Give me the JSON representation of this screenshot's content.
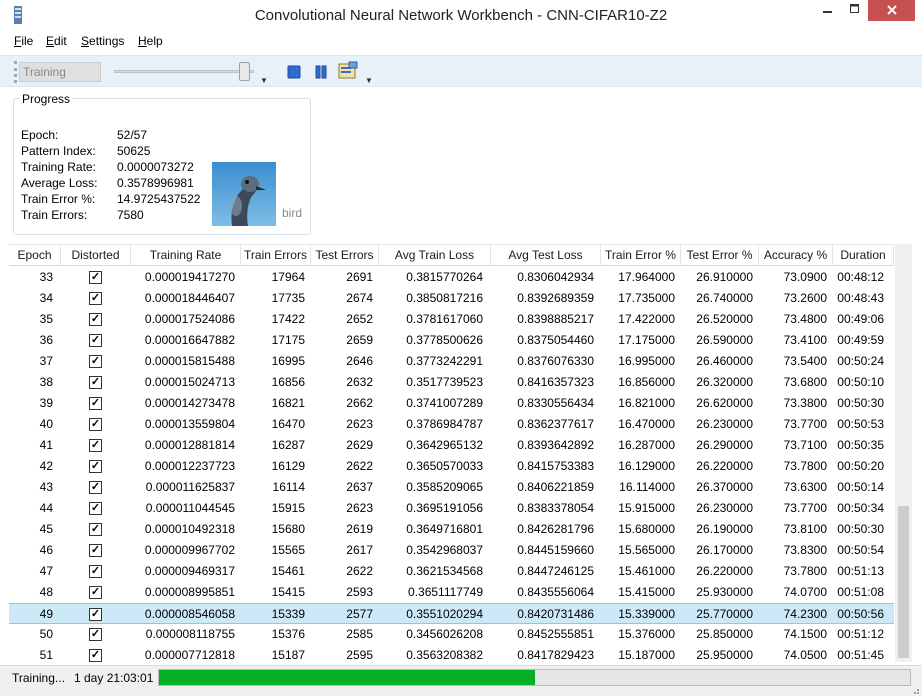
{
  "window": {
    "title": "Convolutional Neural Network Workbench - CNN-CIFAR10-Z2"
  },
  "menu": [
    {
      "label": "File",
      "mnemonic": "F",
      "rest": "ile"
    },
    {
      "label": "Edit",
      "mnemonic": "E",
      "rest": "dit"
    },
    {
      "label": "Settings",
      "mnemonic": "S",
      "rest": "ettings"
    },
    {
      "label": "Help",
      "mnemonic": "H",
      "rest": "elp"
    }
  ],
  "toolbar": {
    "training_field": "Training",
    "slider_level": 1.0,
    "stop_icon": "stop-icon",
    "pause_icon": "pause-icon",
    "settings_icon": "settings-icon"
  },
  "progress": {
    "legend": "Progress",
    "labels": [
      "Epoch:",
      "Pattern Index:",
      "Training Rate:",
      "Average Loss:",
      "Train Error %:",
      "Train Errors:"
    ],
    "values": [
      "52/57",
      "50625",
      "0.0000073272",
      "0.3578996981",
      "14.9725437522",
      "7580"
    ],
    "sample_label": "bird"
  },
  "grid": {
    "columns": [
      "Epoch",
      "Distorted",
      "Training Rate",
      "Train Errors",
      "Test Errors",
      "Avg Train Loss",
      "Avg Test Loss",
      "Train Error %",
      "Test Error %",
      "Accuracy %",
      "Duration"
    ],
    "selected_epoch": "49",
    "rows": [
      [
        "33",
        true,
        "0.000019417270",
        "17964",
        "2691",
        "0.3815770264",
        "0.8306042934",
        "17.964000",
        "26.910000",
        "73.0900",
        "00:48:12"
      ],
      [
        "34",
        true,
        "0.000018446407",
        "17735",
        "2674",
        "0.3850817216",
        "0.8392689359",
        "17.735000",
        "26.740000",
        "73.2600",
        "00:48:43"
      ],
      [
        "35",
        true,
        "0.000017524086",
        "17422",
        "2652",
        "0.3781617060",
        "0.8398885217",
        "17.422000",
        "26.520000",
        "73.4800",
        "00:49:06"
      ],
      [
        "36",
        true,
        "0.000016647882",
        "17175",
        "2659",
        "0.3778500626",
        "0.8375054460",
        "17.175000",
        "26.590000",
        "73.4100",
        "00:49:59"
      ],
      [
        "37",
        true,
        "0.000015815488",
        "16995",
        "2646",
        "0.3773242291",
        "0.8376076330",
        "16.995000",
        "26.460000",
        "73.5400",
        "00:50:24"
      ],
      [
        "38",
        true,
        "0.000015024713",
        "16856",
        "2632",
        "0.3517739523",
        "0.8416357323",
        "16.856000",
        "26.320000",
        "73.6800",
        "00:50:10"
      ],
      [
        "39",
        true,
        "0.000014273478",
        "16821",
        "2662",
        "0.3741007289",
        "0.8330556434",
        "16.821000",
        "26.620000",
        "73.3800",
        "00:50:30"
      ],
      [
        "40",
        true,
        "0.000013559804",
        "16470",
        "2623",
        "0.3786984787",
        "0.8362377617",
        "16.470000",
        "26.230000",
        "73.7700",
        "00:50:53"
      ],
      [
        "41",
        true,
        "0.000012881814",
        "16287",
        "2629",
        "0.3642965132",
        "0.8393642892",
        "16.287000",
        "26.290000",
        "73.7100",
        "00:50:35"
      ],
      [
        "42",
        true,
        "0.000012237723",
        "16129",
        "2622",
        "0.3650570033",
        "0.8415753383",
        "16.129000",
        "26.220000",
        "73.7800",
        "00:50:20"
      ],
      [
        "43",
        true,
        "0.000011625837",
        "16114",
        "2637",
        "0.3585209065",
        "0.8406221859",
        "16.114000",
        "26.370000",
        "73.6300",
        "00:50:14"
      ],
      [
        "44",
        true,
        "0.000011044545",
        "15915",
        "2623",
        "0.3695191056",
        "0.8383378054",
        "15.915000",
        "26.230000",
        "73.7700",
        "00:50:34"
      ],
      [
        "45",
        true,
        "0.000010492318",
        "15680",
        "2619",
        "0.3649716801",
        "0.8426281796",
        "15.680000",
        "26.190000",
        "73.8100",
        "00:50:30"
      ],
      [
        "46",
        true,
        "0.000009967702",
        "15565",
        "2617",
        "0.3542968037",
        "0.8445159660",
        "15.565000",
        "26.170000",
        "73.8300",
        "00:50:54"
      ],
      [
        "47",
        true,
        "0.000009469317",
        "15461",
        "2622",
        "0.3621534568",
        "0.8447246125",
        "15.461000",
        "26.220000",
        "73.7800",
        "00:51:13"
      ],
      [
        "48",
        true,
        "0.000008995851",
        "15415",
        "2593",
        "0.3651117749",
        "0.8435556064",
        "15.415000",
        "25.930000",
        "74.0700",
        "00:51:08"
      ],
      [
        "49",
        true,
        "0.000008546058",
        "15339",
        "2577",
        "0.3551020294",
        "0.8420731486",
        "15.339000",
        "25.770000",
        "74.2300",
        "00:50:56"
      ],
      [
        "50",
        true,
        "0.000008118755",
        "15376",
        "2585",
        "0.3456026208",
        "0.8452555851",
        "15.376000",
        "25.850000",
        "74.1500",
        "00:51:12"
      ],
      [
        "51",
        true,
        "0.000007712818",
        "15187",
        "2595",
        "0.3563208382",
        "0.8417829423",
        "15.187000",
        "25.950000",
        "74.0500",
        "00:51:45"
      ]
    ]
  },
  "status": {
    "state": "Training...",
    "elapsed": "1 day 21:03:01",
    "progress_fraction": 0.5,
    "progress_color": "#06b025"
  }
}
